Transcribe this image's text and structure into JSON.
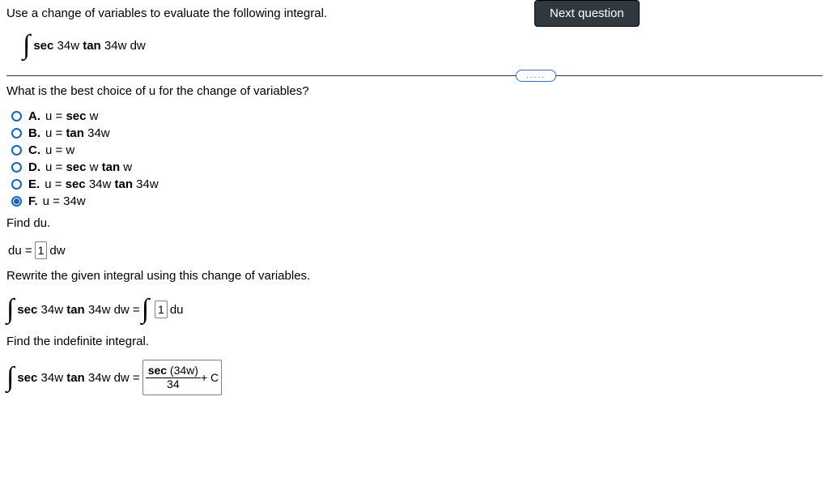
{
  "header": {
    "next_button": "Next question",
    "dots": "....."
  },
  "prompt": {
    "intro": "Use a change of variables to evaluate the following integral.",
    "integral_expr": {
      "sec": "sec",
      "arg1": " 34w ",
      "tan": "tan",
      "arg2": " 34w dw"
    }
  },
  "q1": {
    "text": "What is the best choice of u for the change of variables?",
    "choices": [
      {
        "letter": "A.",
        "pre": "u = ",
        "b1": "sec",
        "mid": " w",
        "b2": "",
        "tail": "",
        "selected": false
      },
      {
        "letter": "B.",
        "pre": "u = ",
        "b1": "tan",
        "mid": " 34w",
        "b2": "",
        "tail": "",
        "selected": false
      },
      {
        "letter": "C.",
        "pre": "u = w",
        "b1": "",
        "mid": "",
        "b2": "",
        "tail": "",
        "selected": false
      },
      {
        "letter": "D.",
        "pre": "u = ",
        "b1": "sec",
        "mid": " w ",
        "b2": "tan",
        "tail": " w",
        "selected": false
      },
      {
        "letter": "E.",
        "pre": "u = ",
        "b1": "sec",
        "mid": " 34w ",
        "b2": "tan",
        "tail": " 34w",
        "selected": false
      },
      {
        "letter": "F.",
        "pre": "u = 34w",
        "b1": "",
        "mid": "",
        "b2": "",
        "tail": "",
        "selected": true
      }
    ]
  },
  "q2": {
    "label": "Find du.",
    "du_prefix": "du = ",
    "du_box": "1",
    "du_suffix": " dw"
  },
  "q3": {
    "label": "Rewrite the given integral using this change of variables.",
    "lhs": {
      "sec": "sec",
      "a1": " 34w ",
      "tan": "tan",
      "a2": " 34w dw = "
    },
    "rhs_box": "1",
    "rhs_suffix": " du"
  },
  "q4": {
    "label": "Find the indefinite integral.",
    "lhs": {
      "sec": "sec",
      "a1": " 34w ",
      "tan": "tan",
      "a2": " 34w dw = "
    },
    "answer": {
      "num_b": "sec",
      "num_rest": " (34w)",
      "den": "34",
      "tail": " + C"
    }
  }
}
